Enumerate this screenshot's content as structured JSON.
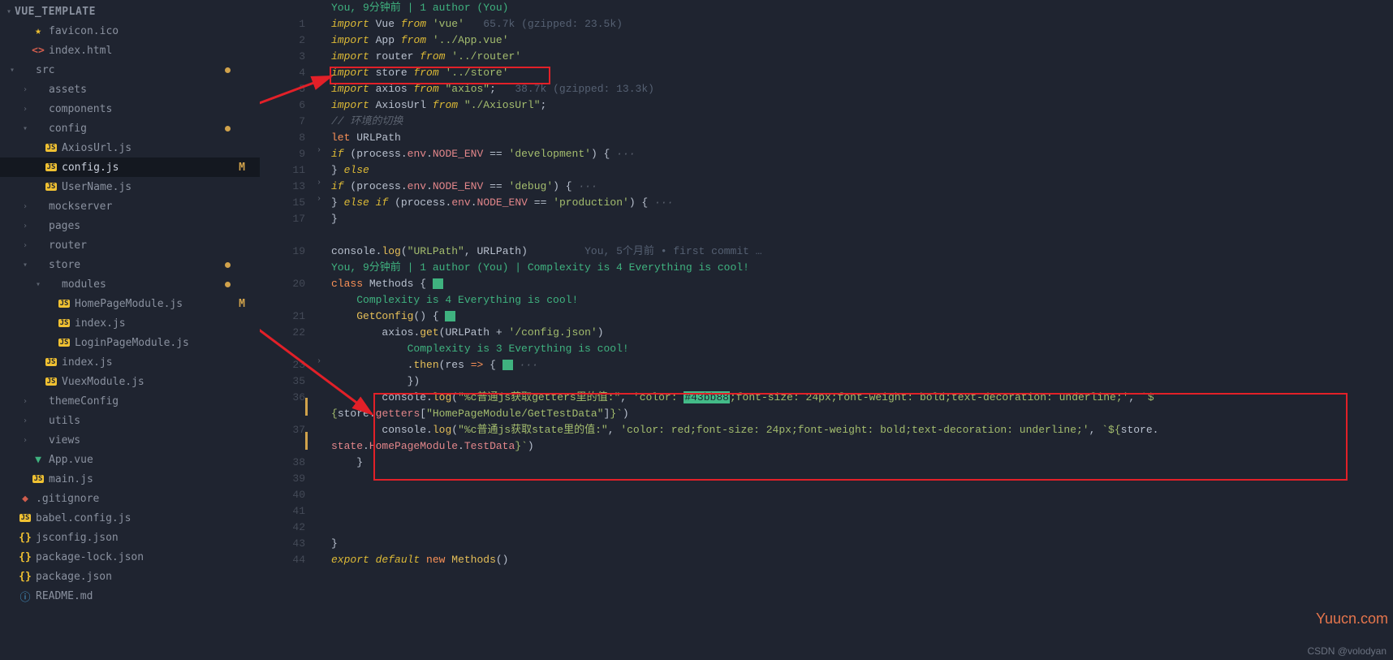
{
  "sidebar": {
    "root": "VUE_TEMPLATE",
    "items": [
      {
        "icon": "star",
        "label": "favicon.ico",
        "depth": 1
      },
      {
        "icon": "html",
        "label": "index.html",
        "depth": 1
      },
      {
        "icon": "folder-open",
        "label": "src",
        "depth": 0,
        "dot": true
      },
      {
        "icon": "folder",
        "label": "assets",
        "depth": 1
      },
      {
        "icon": "folder",
        "label": "components",
        "depth": 1
      },
      {
        "icon": "folder-open",
        "label": "config",
        "depth": 1,
        "dot": true
      },
      {
        "icon": "js",
        "label": "AxiosUrl.js",
        "depth": 2
      },
      {
        "icon": "js",
        "label": "config.js",
        "depth": 2,
        "active": true,
        "mod": "M"
      },
      {
        "icon": "js",
        "label": "UserName.js",
        "depth": 2
      },
      {
        "icon": "folder",
        "label": "mockserver",
        "depth": 1
      },
      {
        "icon": "folder",
        "label": "pages",
        "depth": 1
      },
      {
        "icon": "folder",
        "label": "router",
        "depth": 1
      },
      {
        "icon": "folder-open",
        "label": "store",
        "depth": 1,
        "dot": true
      },
      {
        "icon": "folder-open",
        "label": "modules",
        "depth": 2,
        "dot": true
      },
      {
        "icon": "js",
        "label": "HomePageModule.js",
        "depth": 3,
        "mod": "M"
      },
      {
        "icon": "js",
        "label": "index.js",
        "depth": 3
      },
      {
        "icon": "js",
        "label": "LoginPageModule.js",
        "depth": 3
      },
      {
        "icon": "js",
        "label": "index.js",
        "depth": 2
      },
      {
        "icon": "js",
        "label": "VuexModule.js",
        "depth": 2
      },
      {
        "icon": "folder",
        "label": "themeConfig",
        "depth": 1
      },
      {
        "icon": "folder",
        "label": "utils",
        "depth": 1
      },
      {
        "icon": "folder",
        "label": "views",
        "depth": 1
      },
      {
        "icon": "vue",
        "label": "App.vue",
        "depth": 1
      },
      {
        "icon": "js",
        "label": "main.js",
        "depth": 1
      },
      {
        "icon": "git",
        "label": ".gitignore",
        "depth": 0
      },
      {
        "icon": "js",
        "label": "babel.config.js",
        "depth": 0
      },
      {
        "icon": "brace",
        "label": "jsconfig.json",
        "depth": 0
      },
      {
        "icon": "brace",
        "label": "package-lock.json",
        "depth": 0
      },
      {
        "icon": "brace",
        "label": "package.json",
        "depth": 0
      },
      {
        "icon": "info",
        "label": "README.md",
        "depth": 0
      }
    ]
  },
  "editor": {
    "blame_top": "You, 9分钟前 | 1 author (You)",
    "lines": [
      {
        "n": 1,
        "code": "<kw>import</kw> <var>Vue</var> <kw>from</kw> <str>'vue'</str>   <imp-hint>65.7k (gzipped: 23.5k)</imp-hint>"
      },
      {
        "n": 2,
        "code": "<kw>import</kw> <var>App</var> <kw>from</kw> <str>'../App.vue'</str>"
      },
      {
        "n": 3,
        "code": "<kw>import</kw> <var>router</var> <kw>from</kw> <str>'../router'</str>"
      },
      {
        "n": 4,
        "code": "<kw>import</kw> <var>store</var> <kw>from</kw> <str>'../store'</str>"
      },
      {
        "n": 5,
        "code": "<kw>import</kw> <var>axios</var> <kw>from</kw> <str>\"axios\"</str><pun>;</pun>   <imp-hint>38.7k (gzipped: 13.3k)</imp-hint>"
      },
      {
        "n": 6,
        "code": "<kw>import</kw> <var>AxiosUrl</var> <kw>from</kw> <str>\"./AxiosUrl\"</str><pun>;</pun>"
      },
      {
        "n": 7,
        "code": "<cmt>// 环境的切换</cmt>"
      },
      {
        "n": 8,
        "code": "<kw2>let</kw2> <var>URLPath</var>"
      },
      {
        "n": 9,
        "fold": true,
        "code": "<kw>if</kw> <pun>(</pun><var>process</var><pun>.</pun><prop>env</prop><pun>.</pun><prop>NODE_ENV</prop> <pun>==</pun> <str>'development'</str><pun>) {</pun> <cmt>···</cmt>"
      },
      {
        "n": 11,
        "code": "<pun>}</pun> <kw>else</kw>"
      },
      {
        "n": 13,
        "fold": true,
        "code": "<kw>if</kw> <pun>(</pun><var>process</var><pun>.</pun><prop>env</prop><pun>.</pun><prop>NODE_ENV</prop> <pun>==</pun> <str>'debug'</str><pun>) {</pun> <cmt>···</cmt>"
      },
      {
        "n": 15,
        "fold": true,
        "code": "<pun>}</pun> <kw>else</kw> <kw>if</kw> <pun>(</pun><var>process</var><pun>.</pun><prop>env</prop><pun>.</pun><prop>NODE_ENV</prop> <pun>==</pun> <str>'production'</str><pun>) {</pun> <cmt>···</cmt>"
      },
      {
        "n": 17,
        "code": "<pun>}</pun>"
      },
      {
        "n": "",
        "code": ""
      },
      {
        "n": 19,
        "code": "<var>console</var><pun>.</pun><fn>log</fn><pun>(</pun><str>\"URLPath\"</str><pun>,</pun> <var>URLPath</var><pun>)</pun>         <gitlens>You, 5个月前 • first commit …</gitlens>"
      },
      {
        "n": "",
        "code": "<complex>You, 9分钟前 | 1 author (You) | Complexity is 4 Everything is cool!</complex>"
      },
      {
        "n": 20,
        "code": "<kw2>class</kw2> <var>Methods</var> <pun>{</pun> <span class='green-box'></span>"
      },
      {
        "n": "",
        "code": "    <complex>Complexity is 4 Everything is cool!</complex>"
      },
      {
        "n": 21,
        "code": "    <fn>GetConfig</fn><pun>() {</pun> <span class='green-box'></span>"
      },
      {
        "n": 22,
        "code": "        <var>axios</var><pun>.</pun><fn>get</fn><pun>(</pun><var>URLPath</var> <pun>+</pun> <str>'/config.json'</str><pun>)</pun>"
      },
      {
        "n": "",
        "code": "            <complex>Complexity is 3 Everything is cool!</complex>"
      },
      {
        "n": 23,
        "fold": true,
        "code": "            <pun>.</pun><fn>then</fn><pun>(</pun><var>res</var> <kw2>=></kw2> <pun>{</pun> <span class='green-box'></span> <cmt>···</cmt>",
        "foldAt": ""
      },
      {
        "n": 35,
        "code": "            <pun>})</pun>"
      },
      {
        "n": 36,
        "code": "        <var>console</var><pun>.</pun><fn>log</fn><pun>(</pun><str>\"%c普通js获取getters里的值:\"</str><pun>,</pun> <str>'color: <span class='hex-box'>#43bb88</span>;font-size: 24px;font-weight: bold;text-decoration: underline;'</str><pun>,</pun> <str>`$</str>"
      },
      {
        "n": "",
        "code": "<str>{</str><var>store</var><pun>.</pun><prop>getters</prop><pun>[</pun><str>\"HomePageModule/GetTestData\"</str><pun>]</pun><str>}`</str><pun>)</pun>"
      },
      {
        "n": 37,
        "code": "        <var>console</var><pun>.</pun><fn>log</fn><pun>(</pun><str>\"%c普通js获取state里的值:\"</str><pun>,</pun> <str>'color: red;font-size: 24px;font-weight: bold;text-decoration: underline;'</str><pun>,</pun> <str>`${</str><var>store</var><pun>.</pun>"
      },
      {
        "n": "",
        "code": "<prop>state</prop><pun>.</pun><prop>HomePageModule</prop><pun>.</pun><prop>TestData</prop><str>}`</str><pun>)</pun>"
      },
      {
        "n": 38,
        "code": "    <pun>}</pun>"
      },
      {
        "n": 39,
        "code": ""
      },
      {
        "n": 40,
        "code": ""
      },
      {
        "n": 41,
        "code": ""
      },
      {
        "n": 42,
        "code": ""
      },
      {
        "n": 43,
        "code": "<pun>}</pun>"
      },
      {
        "n": 44,
        "code": "<kw>export</kw> <kw>default</kw> <kw2>new</kw2> <fn>Methods</fn><pun>()</pun>"
      }
    ]
  },
  "watermark": "Yuucn.com",
  "csdn": "CSDN @volodyan"
}
